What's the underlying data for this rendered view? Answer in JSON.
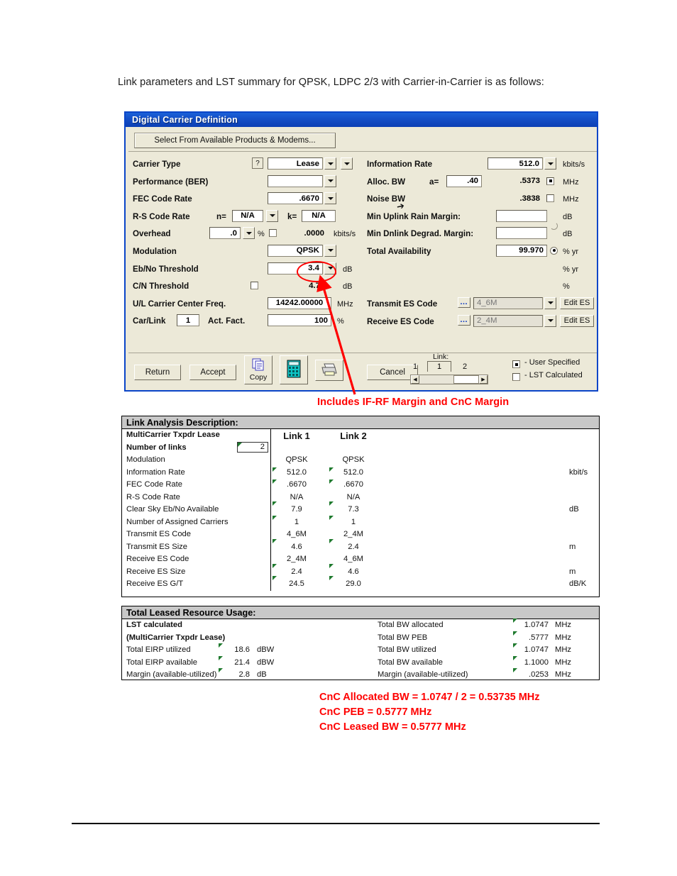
{
  "intro_text": "Link parameters and LST summary for QPSK, LDPC 2/3 with Carrier-in-Carrier is as follows:",
  "dialog": {
    "title": "Digital Carrier Definition",
    "select_products_button": "Select From Available Products & Modems...",
    "help_icon_label": "?",
    "left_fields": [
      {
        "label": "Carrier Type",
        "value": "Lease",
        "unit": ""
      },
      {
        "label": "Performance (BER)",
        "value": "",
        "unit": ""
      },
      {
        "label": "FEC Code Rate",
        "value": ".6670",
        "unit": ""
      },
      {
        "label": "R-S Code Rate",
        "n_label": "n=",
        "n_value": "N/A",
        "k_label": "k=",
        "k_value": "N/A"
      },
      {
        "label": "Overhead",
        "value": ".0",
        "pct": "%",
        "value2": ".0000",
        "unit": "kbits/s"
      },
      {
        "label": "Modulation",
        "value": "QPSK",
        "unit": ""
      },
      {
        "label": "Eb/No Threshold",
        "value": "3.4",
        "unit": "dB"
      },
      {
        "label": "C/N Threshold",
        "value": "4.7",
        "unit": "dB"
      },
      {
        "label": "U/L Carrier Center Freq.",
        "value": "14242.00000",
        "unit": "MHz"
      },
      {
        "label": "Car/Link",
        "value": "1",
        "label2": "Act. Fact.",
        "value2": "100",
        "unit": "%"
      }
    ],
    "right_fields": [
      {
        "label": "Information Rate",
        "value": "512.0",
        "unit": "kbits/s"
      },
      {
        "label": "Alloc. BW",
        "a_label": "a=",
        "a_value": ".40",
        "value": ".5373",
        "unit": "MHz"
      },
      {
        "label": "Noise BW",
        "value": ".3838",
        "unit": "MHz"
      },
      {
        "label": "Min Uplink Rain Margin:",
        "value": "",
        "unit": "dB"
      },
      {
        "label": "Min Dnlink Degrad. Margin:",
        "value": "",
        "unit": "dB"
      },
      {
        "label": "Total Availability",
        "value": "99.970",
        "unit": "% yr"
      },
      {
        "label": "",
        "value": "",
        "unit": "% yr"
      },
      {
        "label": "",
        "value": "",
        "unit": "%"
      }
    ],
    "es_rows": [
      {
        "label": "Transmit ES Code",
        "value": "4_6M",
        "edit_label": "Edit ES"
      },
      {
        "label": "Receive ES Code",
        "value": "2_4M",
        "edit_label": "Edit ES"
      }
    ],
    "buttons": {
      "return": "Return",
      "accept": "Accept",
      "copy": "Copy",
      "cancel": "Cancel"
    },
    "icons": {
      "calculator": "calculator-icon",
      "printer": "printer-icon",
      "copy": "copy-icon"
    },
    "link_selector": {
      "caption": "Link:",
      "value": "1",
      "min_label": "1",
      "max_label": "2"
    },
    "legend": [
      {
        "label": "- User Specified",
        "marker": "checked"
      },
      {
        "label": "- LST Calculated",
        "marker": "unchecked"
      }
    ]
  },
  "annotations": {
    "arrow_note": "Includes IF-RF Margin and CnC Margin",
    "cnc_lines": [
      "CnC Allocated BW = 1.0747 / 2 = 0.53735 MHz",
      "CnC PEB = 0.5777 MHz",
      "CnC Leased BW = 0.5777 MHz"
    ],
    "color": "#ff0000"
  },
  "link_analysis": {
    "header": "Link Analysis Description:",
    "subtitle": "MultiCarrier Txpdr Lease",
    "number_of_links_label": "Number of links",
    "number_of_links_value": "2",
    "col1_header": "Link 1",
    "col2_header": "Link 2",
    "rows": [
      {
        "name": "Modulation",
        "c1": "QPSK",
        "c2": "QPSK",
        "unit": ""
      },
      {
        "name": "Information Rate",
        "c1": "512.0",
        "c2": "512.0",
        "unit": "kbit/s"
      },
      {
        "name": "FEC Code Rate",
        "c1": ".6670",
        "c2": ".6670",
        "unit": ""
      },
      {
        "name": "R-S Code Rate",
        "c1": "N/A",
        "c2": "N/A",
        "unit": ""
      },
      {
        "name": "Clear Sky  Eb/No Available",
        "c1": "7.9",
        "c2": "7.3",
        "unit": "dB"
      },
      {
        "name": "Number of Assigned Carriers",
        "c1": "1",
        "c2": "1",
        "unit": ""
      },
      {
        "name": "Transmit ES Code",
        "c1": "4_6M",
        "c2": "2_4M",
        "unit": ""
      },
      {
        "name": "Transmit ES Size",
        "c1": "4.6",
        "c2": "2.4",
        "unit": "m"
      },
      {
        "name": "Receive ES Code",
        "c1": "2_4M",
        "c2": "4_6M",
        "unit": ""
      },
      {
        "name": "Receive ES Size",
        "c1": "2.4",
        "c2": "4.6",
        "unit": "m"
      },
      {
        "name": "Receive ES G/T",
        "c1": "24.5",
        "c2": "29.0",
        "unit": "dB/K"
      }
    ]
  },
  "leased_usage": {
    "header": "Total Leased Resource Usage:",
    "rows": [
      {
        "name": "LST calculated",
        "val": "",
        "unit": "",
        "name2": "Total BW allocated",
        "val2": "1.0747",
        "unit2": "MHz"
      },
      {
        "name": "(MultiCarrier Txpdr Lease)",
        "val": "",
        "unit": "",
        "name2": "Total BW PEB",
        "val2": ".5777",
        "unit2": "MHz"
      },
      {
        "name": "Total EIRP utilized",
        "val": "18.6",
        "unit": "dBW",
        "name2": "Total BW utilized",
        "val2": "1.0747",
        "unit2": "MHz"
      },
      {
        "name": "Total EIRP available",
        "val": "21.4",
        "unit": "dBW",
        "name2": "Total BW available",
        "val2": "1.1000",
        "unit2": "MHz"
      },
      {
        "name": "Margin (available-utilized)",
        "val": "2.8",
        "unit": "dB",
        "name2": "Margin (available-utilized)",
        "val2": ".0253",
        "unit2": "MHz"
      }
    ]
  }
}
